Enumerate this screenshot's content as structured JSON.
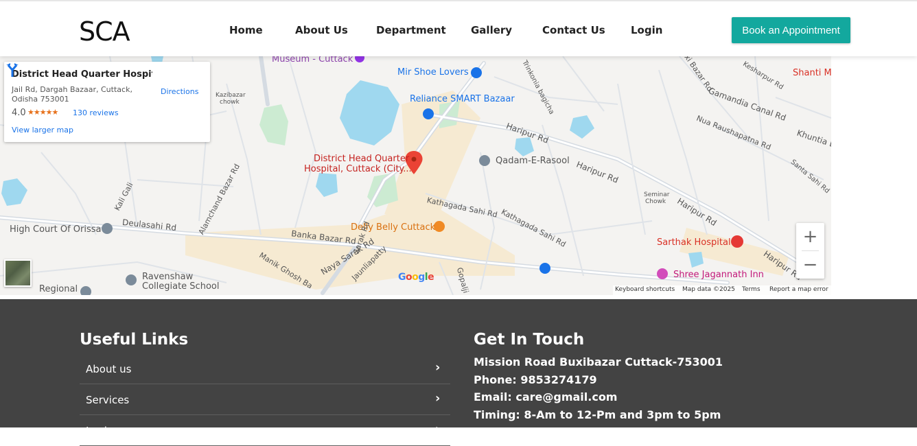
{
  "header": {
    "logo": "SCA",
    "nav": [
      "Home",
      "About Us",
      "Department",
      "Gallery",
      "Contact Us",
      "Login"
    ],
    "cta": "Book an Appointment"
  },
  "map": {
    "card": {
      "name": "District Head Quarter Hospital...",
      "address": "Jail Rd, Dargah Bazaar, Cuttack, Odisha 753001",
      "rating": "4.0",
      "stars": "★★★★★",
      "reviews": "130 reviews",
      "directions": "Directions",
      "larger_map": "View larger map"
    },
    "marker_label_1": "District Head Quarter",
    "marker_label_2": "Hospital, Cuttack (City...",
    "places": {
      "museum": "Museum - Cuttack",
      "mir_shoe": "Mir Shoe Lovers",
      "reliance": "Reliance SMART Bazaar",
      "qadam": "Qadam-E-Rasool",
      "high_court": "High Court Of Orissa",
      "delly": "Delly Belly Cuttack",
      "ravenshaw_1": "Ravenshaw",
      "ravenshaw_2": "Collegiate School",
      "regional": "Regional",
      "sarthak": "Sarthak Hospital",
      "jagannath": "Shree Jagannath Inn",
      "shanti": "Shanti M",
      "kazibazar_1": "Kazibazar",
      "kazibazar_2": "chowk",
      "seminar_1": "Seminar",
      "seminar_2": "Chowk"
    },
    "roads": {
      "haripur_1": "Haripur Rd",
      "haripur_2": "Haripur Rd",
      "haripur_3": "Haripur Rd",
      "haripur_4": "Haripur Rd",
      "deulasahi": "Deulasahi Rd",
      "banka": "Banka Bazar Rd",
      "naya": "Naya Sarak Rd",
      "kathagada_1": "Kathagada Sahi Rd",
      "kathagada_2": "Kathagada Sahi Rd",
      "gamandia": "Gamandia Canal Rd",
      "nua": "Nua Raushapatna Rd",
      "alamchand": "Alamchand Bazar Rd",
      "kali": "Kali Gali",
      "manik": "Manik Ghosh Ba",
      "jaunlia": "Jaunliapatty",
      "sarak": "Sarak Rd",
      "trinkonia": "Trinkonia bagicha",
      "kesharpur": "Kesharpur Rd",
      "khuntia": "Khuntia L",
      "santa": "Santa Sahi Rd",
      "gopal": "Gopalji",
      "buxi": "Buxi Bazar Rd"
    },
    "attribution": [
      "Keyboard shortcuts",
      "Map data ©2025",
      "Terms",
      "Report a map error"
    ],
    "google": "Google",
    "zoom_in": "+",
    "zoom_out": "−"
  },
  "footer": {
    "useful_links_title": "Useful Links",
    "useful_links": [
      "About us",
      "Services",
      "Login"
    ],
    "chevron": "›",
    "get_in_touch_title": "Get In Touch",
    "contact": [
      "Mission Road Buxibazar Cuttack-753001",
      "Phone: 9853274179",
      "Email: care@gmail.com",
      "Timing: 8-Am to 12-Pm and 3pm to 5pm"
    ]
  },
  "colors": {
    "brand": "#13a89e",
    "footer_bg": "#434343",
    "map_bg": "#f4f3f1"
  }
}
